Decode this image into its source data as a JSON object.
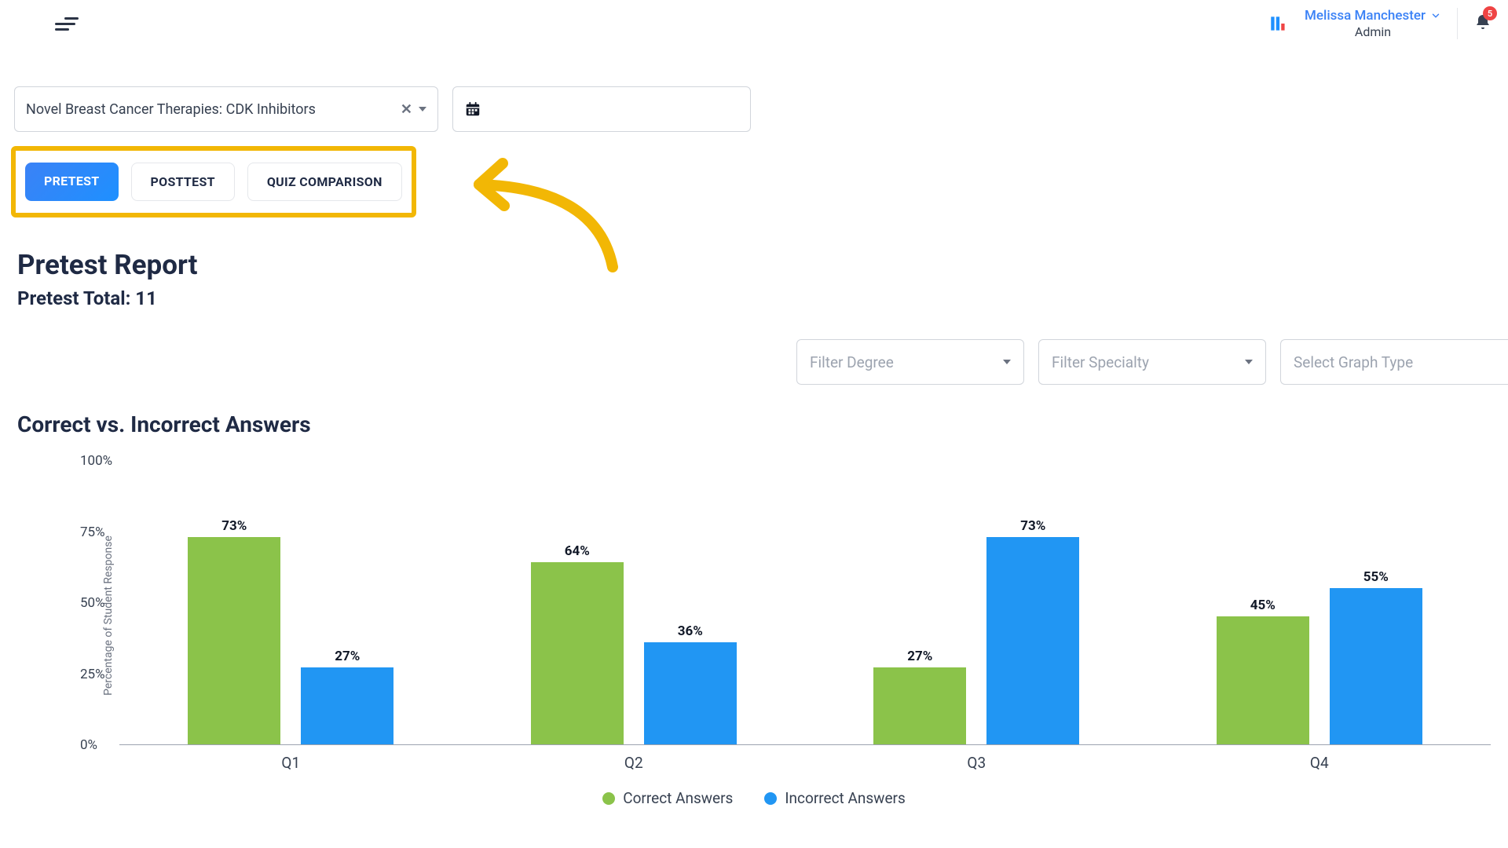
{
  "header": {
    "user_name": "Melissa Manchester",
    "user_role": "Admin",
    "notification_count": "5"
  },
  "filters": {
    "course": "Novel Breast Cancer Therapies: CDK Inhibitors"
  },
  "tabs": {
    "pretest": "PRETEST",
    "posttest": "POSTTEST",
    "quiz_comparison": "QUIZ COMPARISON"
  },
  "report": {
    "title": "Pretest Report",
    "subtitle": "Pretest Total: 11"
  },
  "right_filters": {
    "degree": "Filter Degree",
    "specialty": "Filter Specialty",
    "graph_type": "Select Graph Type"
  },
  "chart_title": "Correct vs. Incorrect Answers",
  "legend": {
    "correct": "Correct Answers",
    "incorrect": "Incorrect Answers"
  },
  "chart_data": {
    "type": "bar",
    "title": "Correct vs. Incorrect Answers",
    "xlabel": "",
    "ylabel": "Percentage of Student Response",
    "categories": [
      "Q1",
      "Q2",
      "Q3",
      "Q4"
    ],
    "series": [
      {
        "name": "Correct Answers",
        "values": [
          73,
          64,
          27,
          45
        ],
        "color": "#8bc34a"
      },
      {
        "name": "Incorrect Answers",
        "values": [
          27,
          36,
          73,
          55
        ],
        "color": "#2196f3"
      }
    ],
    "ylim": [
      0,
      100
    ],
    "yticks": [
      0,
      25,
      50,
      75,
      100
    ],
    "value_suffix": "%"
  }
}
